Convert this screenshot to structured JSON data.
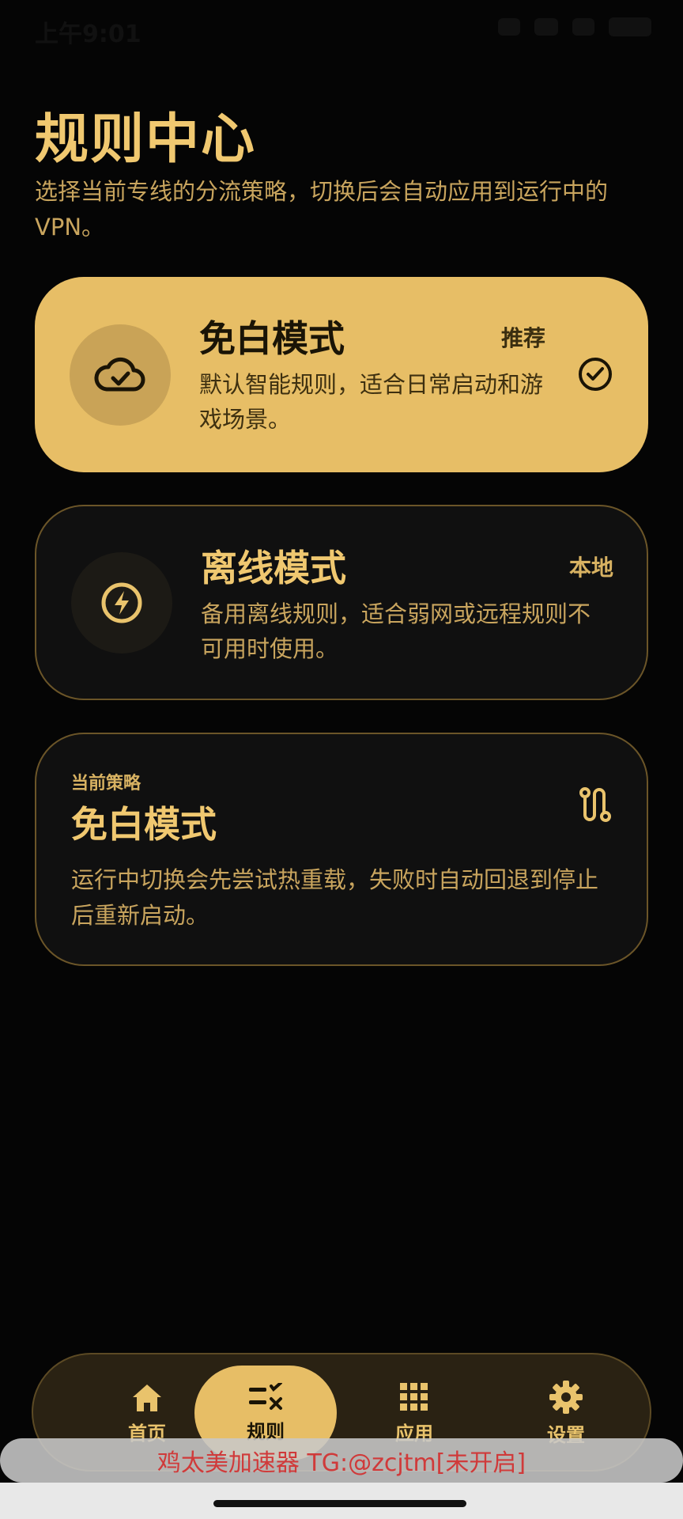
{
  "status_bar": {
    "time": "上午9:01"
  },
  "header": {
    "title": "规则中心",
    "subtitle": "选择当前专线的分流策略，切换后会自动应用到运行中的VPN。"
  },
  "modes": [
    {
      "title": "免白模式",
      "badge": "推荐",
      "description": "默认智能规则，适合日常启动和游戏场景。",
      "selected": true,
      "icon": "cloud-check-icon"
    },
    {
      "title": "离线模式",
      "badge": "本地",
      "description": "备用离线规则，适合弱网或远程规则不可用时使用。",
      "selected": false,
      "icon": "bolt-icon"
    }
  ],
  "current_strategy": {
    "label": "当前策略",
    "title": "免白模式",
    "description": "运行中切换会先尝试热重载，失败时自动回退到停止后重新启动。",
    "icon": "route-icon"
  },
  "nav": {
    "items": [
      {
        "label": "首页",
        "icon": "home-icon"
      },
      {
        "label": "规则",
        "icon": "rules-icon",
        "active": true
      },
      {
        "label": "应用",
        "icon": "apps-grid-icon"
      },
      {
        "label": "设置",
        "icon": "gear-icon"
      }
    ]
  },
  "toast": {
    "text": "鸡太美加速器 TG:@zcjtm[未开启]"
  },
  "colors": {
    "accent": "#e7be66",
    "background": "#050505",
    "card_dark": "#101010",
    "toast_text": "#d03a3a"
  }
}
